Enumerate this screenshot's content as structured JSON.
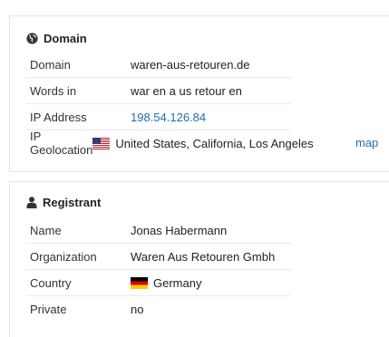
{
  "domain_section": {
    "title": "Domain",
    "icon": "globe-icon",
    "rows": [
      {
        "label": "Domain",
        "value": "waren-aus-retouren.de"
      },
      {
        "label": "Words in",
        "value": "war en a us retour en"
      },
      {
        "label": "IP Address",
        "value": "198.54.126.84"
      },
      {
        "label": "IP Geolocation",
        "value": "United States, California, Los Angeles",
        "flag": "us-flag-icon",
        "link": "map"
      }
    ]
  },
  "registrant_section": {
    "title": "Registrant",
    "icon": "user-icon",
    "rows": [
      {
        "label": "Name",
        "value": "Jonas Habermann"
      },
      {
        "label": "Organization",
        "value": "Waren Aus Retouren Gmbh"
      },
      {
        "label": "Country",
        "value": "Germany",
        "flag": "germany-flag-icon"
      },
      {
        "label": "Private",
        "value": "no"
      }
    ]
  },
  "colors": {
    "link": "#1f6fb5",
    "border": "#e3e3e3"
  }
}
